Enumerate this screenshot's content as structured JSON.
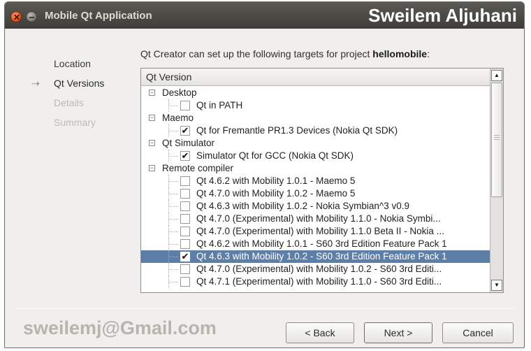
{
  "window": {
    "title": "Mobile Qt Application",
    "brand": "Sweilem Aljuhani",
    "watermark": "sweilemj@Gmail.com"
  },
  "steps": [
    {
      "label": "Location",
      "state": "done"
    },
    {
      "label": "Qt Versions",
      "state": "current"
    },
    {
      "label": "Details",
      "state": "future"
    },
    {
      "label": "Summary",
      "state": "future"
    }
  ],
  "intro": {
    "prefix": "Qt Creator can set up the following targets for project ",
    "project": "hellomobile",
    "suffix": ":"
  },
  "tree": {
    "header": "Qt Version",
    "groups": [
      {
        "label": "Desktop",
        "expander": "−",
        "items": [
          {
            "label": "Qt in PATH",
            "checked": false
          }
        ]
      },
      {
        "label": "Maemo",
        "expander": "−",
        "items": [
          {
            "label": "Qt for Fremantle PR1.3 Devices (Nokia Qt SDK)",
            "checked": true
          }
        ]
      },
      {
        "label": "Qt Simulator",
        "expander": "−",
        "items": [
          {
            "label": "Simulator Qt for GCC (Nokia Qt SDK)",
            "checked": true
          }
        ]
      },
      {
        "label": "Remote compiler",
        "expander": "−",
        "items": [
          {
            "label": "Qt 4.6.2 with Mobility 1.0.1 - Maemo 5",
            "checked": false
          },
          {
            "label": "Qt 4.7.0 with Mobility 1.0.2 - Maemo 5",
            "checked": false
          },
          {
            "label": "Qt 4.6.3 with Mobility 1.0.2 - Nokia Symbian^3 v0.9",
            "checked": false
          },
          {
            "label": "Qt 4.7.0 (Experimental) with Mobility 1.1.0 - Nokia Symbi...",
            "checked": false
          },
          {
            "label": "Qt 4.7.0 (Experimental) with Mobility 1.1.0 Beta II - Nokia ...",
            "checked": false
          },
          {
            "label": "Qt 4.6.2 with Mobility 1.0.1 - S60 3rd Edition Feature Pack 1",
            "checked": false
          },
          {
            "label": "Qt 4.6.3 with Mobility 1.0.2 - S60 3rd Edition Feature Pack 1",
            "checked": true,
            "selected": true
          },
          {
            "label": "Qt 4.7.0 (Experimental) with Mobility 1.0.2 - S60 3rd Editi...",
            "checked": false
          },
          {
            "label": "Qt 4.7.1 (Experimental) with Mobility 1.1.0 - S60 3rd Editi...",
            "checked": false
          }
        ]
      }
    ]
  },
  "buttons": {
    "back": "< Back",
    "next": "Next >",
    "cancel": "Cancel"
  },
  "icons": {
    "check": "✔",
    "step_arrow": "⇢",
    "scroll_up": "▲",
    "scroll_down": "▼"
  }
}
